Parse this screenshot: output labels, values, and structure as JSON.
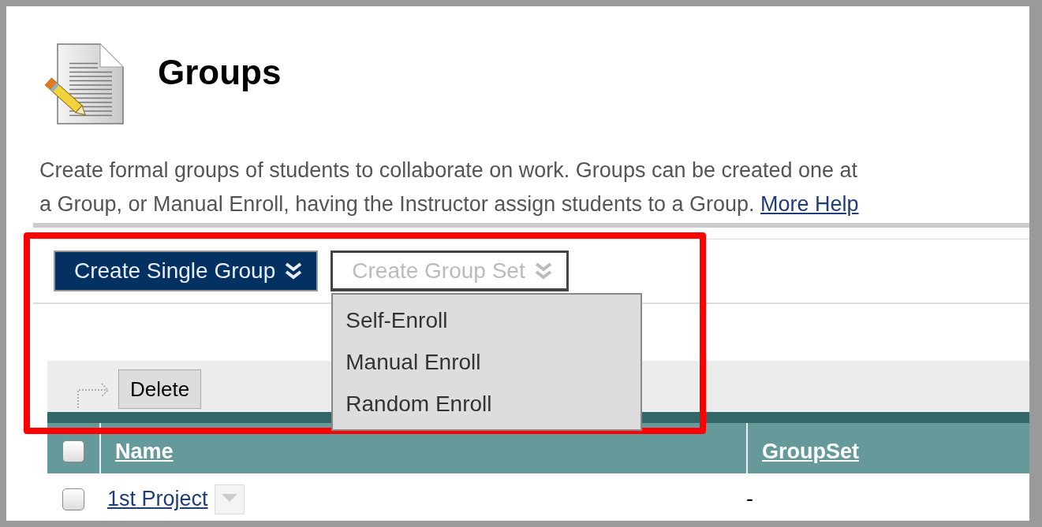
{
  "header": {
    "title": "Groups"
  },
  "description": {
    "lines": [
      "Create formal groups of students to collaborate on work. Groups can be created one at",
      "a Group, or Manual Enroll, having the Instructor assign students to a Group."
    ],
    "link": "More Help"
  },
  "toolbar": {
    "buttons": [
      {
        "label": "Create Single Group",
        "kind": "primary",
        "expanded": false
      },
      {
        "label": "Create Group Set",
        "kind": "secondary",
        "expanded": true,
        "menu": [
          "Self-Enroll",
          "Manual Enroll",
          "Random Enroll"
        ]
      }
    ]
  },
  "action_bar": {
    "buttons": [
      "Delete"
    ]
  },
  "table": {
    "select_all": {
      "checked": false
    },
    "columns": [
      "Name",
      "GroupSet"
    ],
    "rows": [
      {
        "checked": false,
        "name": "1st Project",
        "groupset": "-"
      }
    ]
  },
  "annotation": {
    "kind": "highlight"
  }
}
